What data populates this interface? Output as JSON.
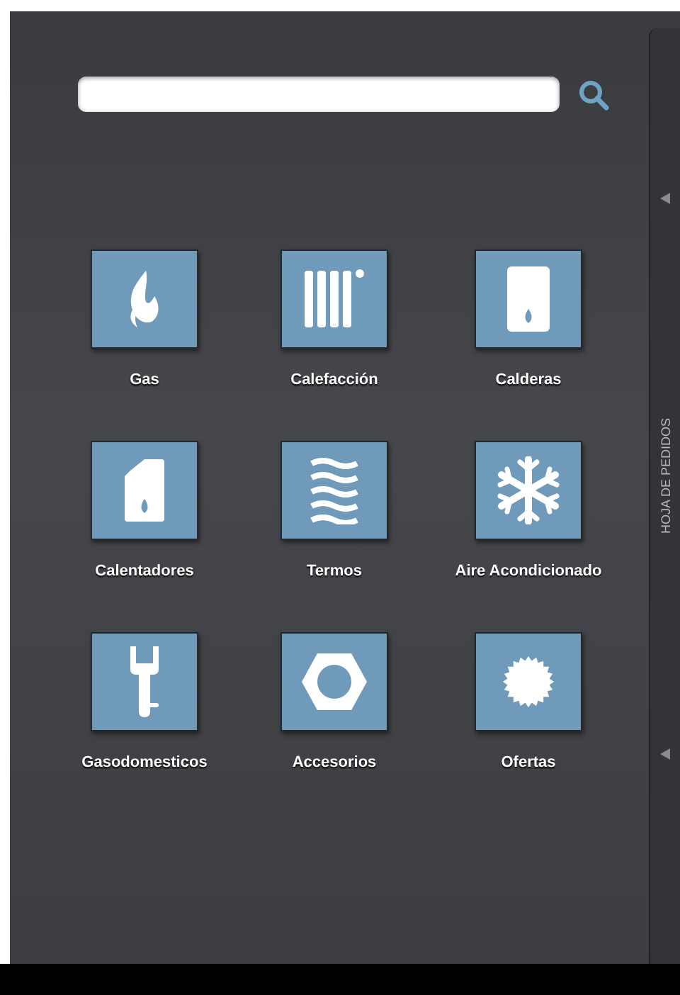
{
  "categories": [
    {
      "label": "Gas",
      "kind": "flame"
    },
    {
      "label": "Calefacción",
      "kind": "radiator"
    },
    {
      "label": "Calderas",
      "kind": "boiler"
    },
    {
      "label": "Calentadores",
      "kind": "heater"
    },
    {
      "label": "Termos",
      "kind": "waves"
    },
    {
      "label": "Aire Acondicionado",
      "kind": "snowflake"
    },
    {
      "label": "Gasodomesticos",
      "kind": "wrench"
    },
    {
      "label": "Accesorios",
      "kind": "nut"
    },
    {
      "label": "Ofertas",
      "kind": "seal"
    }
  ],
  "side_panel": {
    "title": "HOJA DE PEDIDOS"
  }
}
